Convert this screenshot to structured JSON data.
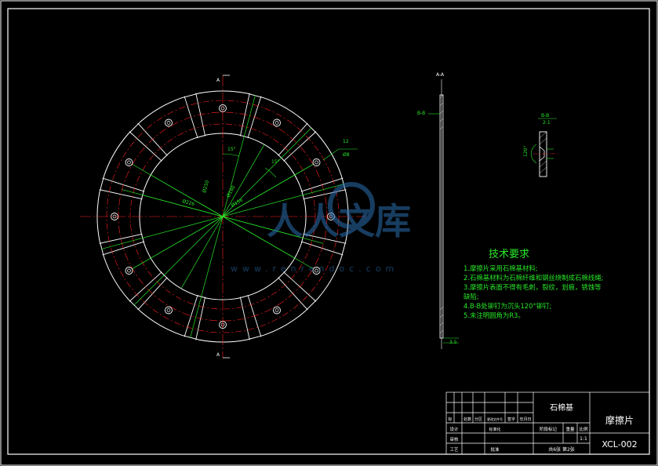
{
  "drawing": {
    "material": "石棉基",
    "part_name": "摩擦片",
    "drawing_no": "XCL-002",
    "scale": "1:1",
    "sheet_info": "共6张 第2张"
  },
  "title_block": {
    "r1": [
      "标",
      "处数",
      "分区",
      "更改文件号",
      "签字",
      "年月日"
    ],
    "design": "设计",
    "standardize": "标准化",
    "stage_mark": "阶段标记",
    "weight": "重量",
    "ratio": "比例",
    "review": "审核",
    "craft": "工艺",
    "approve": "批准"
  },
  "views": {
    "section_aa": "A-A",
    "section_bb": "B-B",
    "bb_scale": "2:1",
    "cut_a_top": "A",
    "cut_a_bottom": "A",
    "cut_b": "B-B"
  },
  "dimensions": {
    "angle_15": "15°",
    "angle_15b": "15°",
    "holes_count": "12",
    "holes_dia": "Ø8",
    "d_outer": "Ø250",
    "d_mid": "Ø190",
    "d_bolt": "Ø226",
    "d_inner": "Ø156",
    "thickness": "3.5",
    "countersink": "120°"
  },
  "tech": {
    "heading": "技术要求",
    "lines": [
      "1.摩擦片采用石棉基材料;",
      "2.石棉基材料为石棉纤维和钢丝绕制成石棉线绳;",
      "3.摩擦片表面不得有毛刺，裂纹，划痕，锈蚀等",
      "缺陷;",
      "4.B-B处铆钉为沉头120°铆钉;",
      "5.未注明圆角为R3。"
    ]
  },
  "watermark": {
    "main": "人人文库",
    "url": "www.renrendoc.com"
  },
  "colors": {
    "background": "#000000",
    "lines": "#ffffff",
    "centerline": "#ff2020",
    "dimension": "#28e628",
    "watermark": "#2a6fb0"
  }
}
